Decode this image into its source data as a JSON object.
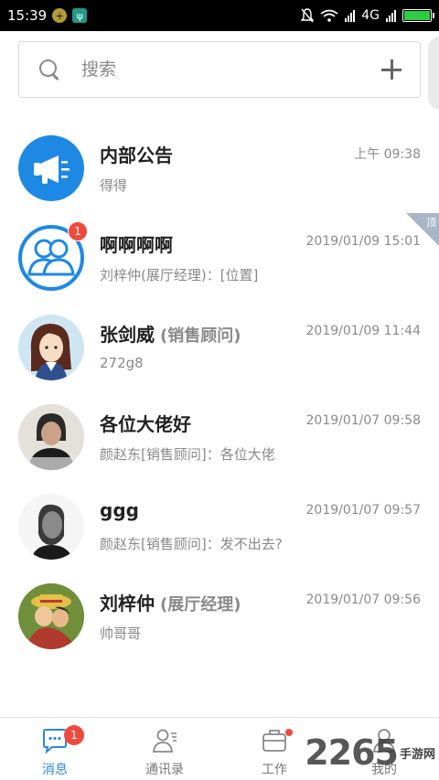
{
  "status_bar": {
    "time": "15:39",
    "network": "4G",
    "icons": [
      "notification-chip-icon",
      "app-chip-icon",
      "mute-icon",
      "wifi-icon",
      "signal-icon",
      "battery-icon"
    ]
  },
  "search": {
    "placeholder": "搜索"
  },
  "chats": [
    {
      "title": "内部公告",
      "role": "",
      "preview": "得得",
      "time": "上午 09:38",
      "avatar": "megaphone-icon",
      "badge": "",
      "pinned": false
    },
    {
      "title": "啊啊啊啊",
      "role": "",
      "preview": "刘梓仲(展厅经理)：[位置]",
      "time": "2019/01/09 15:01",
      "avatar": "group-icon",
      "badge": "1",
      "pinned": true,
      "pin_label": "顶"
    },
    {
      "title": "张剑威",
      "role": "(销售顾问)",
      "preview": "272g8",
      "time": "2019/01/09 11:44",
      "avatar": "cartoon-avatar",
      "badge": "",
      "pinned": false
    },
    {
      "title": "各位大佬好",
      "role": "",
      "preview": "颜赵东[销售顾问]：各位大佬",
      "time": "2019/01/07 09:58",
      "avatar": "group-photo-avatar",
      "badge": "",
      "pinned": false
    },
    {
      "title": "ggg",
      "role": "",
      "preview": "颜赵东[销售顾问]：发不出去?",
      "time": "2019/01/07 09:57",
      "avatar": "portrait-avatar",
      "badge": "",
      "pinned": false
    },
    {
      "title": "刘梓仲",
      "role": "(展厅经理)",
      "preview": "帅哥哥",
      "time": "2019/01/07 09:56",
      "avatar": "anime-avatar",
      "badge": "",
      "pinned": false
    }
  ],
  "tabs": [
    {
      "label": "消息",
      "icon": "message-icon",
      "active": true,
      "badge": "1"
    },
    {
      "label": "通讯录",
      "icon": "contacts-icon",
      "active": false,
      "badge": ""
    },
    {
      "label": "工作",
      "icon": "briefcase-icon",
      "active": false,
      "dot": true
    },
    {
      "label": "我的",
      "icon": "profile-icon",
      "active": false,
      "badge": ""
    }
  ],
  "watermark": {
    "number": "2265",
    "text": "手游网"
  },
  "colors": {
    "accent": "#2b87e0",
    "badge": "#ee4b3e",
    "pin": "#a9b6c8"
  }
}
